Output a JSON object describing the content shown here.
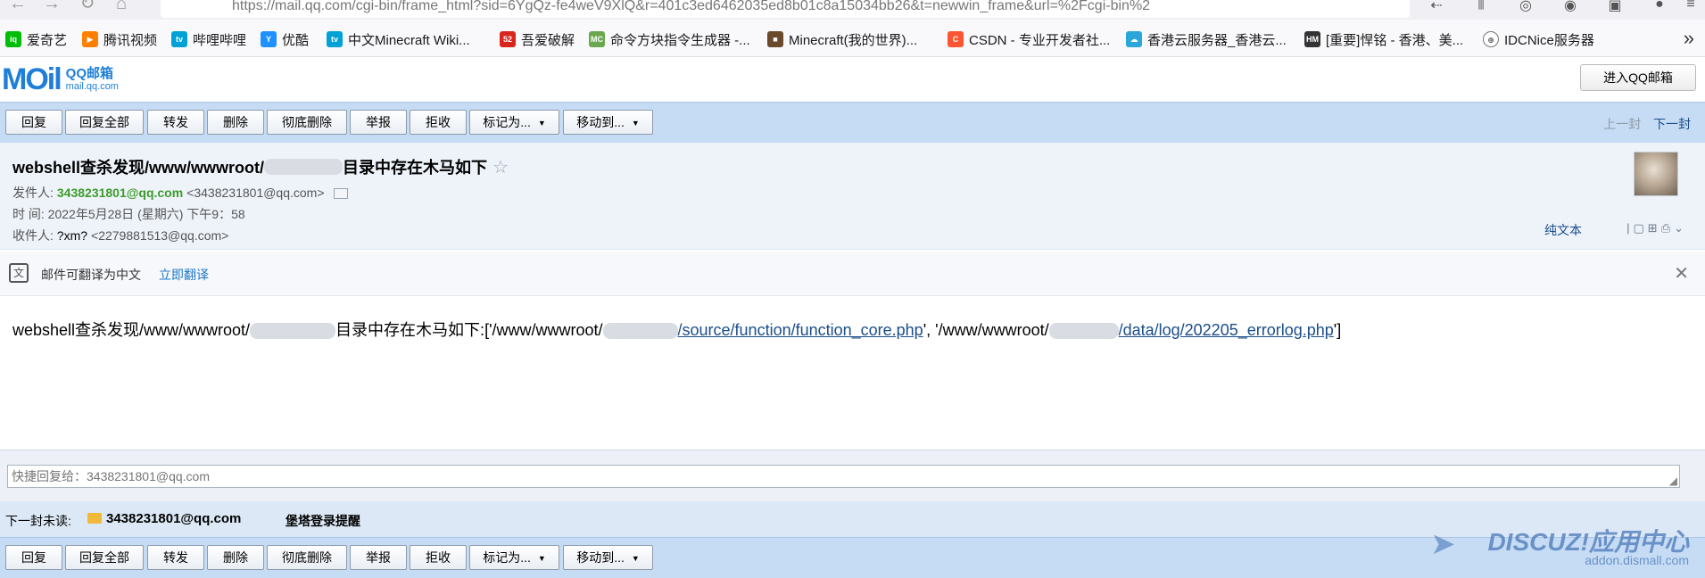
{
  "browser": {
    "url": "https://mail.qq.com/cgi-bin/frame_html?sid=6YgQz-fe4weV9XlQ&r=401c3ed6462035ed8b01c8a15034bb26&t=newwin_frame&url=%2Fcgi-bin%2"
  },
  "bookmarks": [
    {
      "label": "爱奇艺",
      "icon": "iqiyi-icon",
      "color": "#00be06"
    },
    {
      "label": "腾讯视频",
      "icon": "tencent-video-icon",
      "color": "#ff7f00"
    },
    {
      "label": "哔哩哔哩",
      "icon": "bilibili-icon",
      "color": "#00a1d6"
    },
    {
      "label": "优酷",
      "icon": "youku-icon",
      "color": "#1e90ff"
    },
    {
      "label": "中文Minecraft Wiki...",
      "icon": "bilibili-icon",
      "color": "#00a1d6"
    },
    {
      "label": "吾爱破解",
      "icon": "52pojie-icon",
      "color": "#d9261c"
    },
    {
      "label": "命令方块指令生成器 -...",
      "icon": "mc-icon",
      "color": "#6aa84f"
    },
    {
      "label": "Minecraft(我的世界)...",
      "icon": "minecraft-block-icon",
      "color": "#6b4a2b"
    },
    {
      "label": "CSDN - 专业开发者社...",
      "icon": "csdn-icon",
      "color": "#fc5531"
    },
    {
      "label": "香港云服务器_香港云...",
      "icon": "cloud-icon",
      "color": "#2aa6d8"
    },
    {
      "label": "[重要]悍铭 - 香港、美...",
      "icon": "hm-icon",
      "color": "#333333"
    },
    {
      "label": "IDCNice服务器",
      "icon": "globe-icon",
      "color": "#555555"
    }
  ],
  "header": {
    "logo_main": "MOil",
    "logo_sub1": "QQ邮箱",
    "logo_sub2": "mail.qq.com",
    "enter_button": "进入QQ邮箱"
  },
  "toolbar": {
    "reply": "回复",
    "reply_all": "回复全部",
    "forward": "转发",
    "delete": "删除",
    "delete_permanent": "彻底删除",
    "report": "举报",
    "reject": "拒收",
    "mark_as": "标记为...",
    "move_to": "移动到...",
    "prev": "上一封",
    "next": "下一封"
  },
  "mail": {
    "subject_part1": "webshell查杀发现/www/wwwroot/",
    "subject_part2": "目录中存在木马如下",
    "from_label": "发件人:",
    "from_name": "3438231801@qq.com",
    "from_addr": "<3438231801@qq.com>",
    "time_label": "时   间:",
    "time_value": "2022年5月28日 (星期六) 下午9：58",
    "to_label": "收件人:",
    "to_name": "?xm?",
    "to_addr": "<2279881513@qq.com>",
    "plain_text": "纯文本",
    "body_part1": "webshell查杀发现/www/wwwroot/",
    "body_part2": "目录中存在木马如下:['/www/wwwroot/",
    "body_link1": "/source/function/function_core.php",
    "body_part3": "', '/www/wwwroot/",
    "body_link2": "/data/log/202205_errorlog.php",
    "body_part4": "']"
  },
  "translate": {
    "text": "邮件可翻译为中文",
    "link": "立即翻译"
  },
  "quick_reply": {
    "placeholder": "快捷回复给：3438231801@qq.com"
  },
  "next_unread": {
    "label": "下一封未读:",
    "sender": "3438231801@qq.com",
    "subject": "堡塔登录提醒"
  },
  "watermark": {
    "main": "DISCUZ!应用中心",
    "sub": "addon.dismall.com"
  }
}
